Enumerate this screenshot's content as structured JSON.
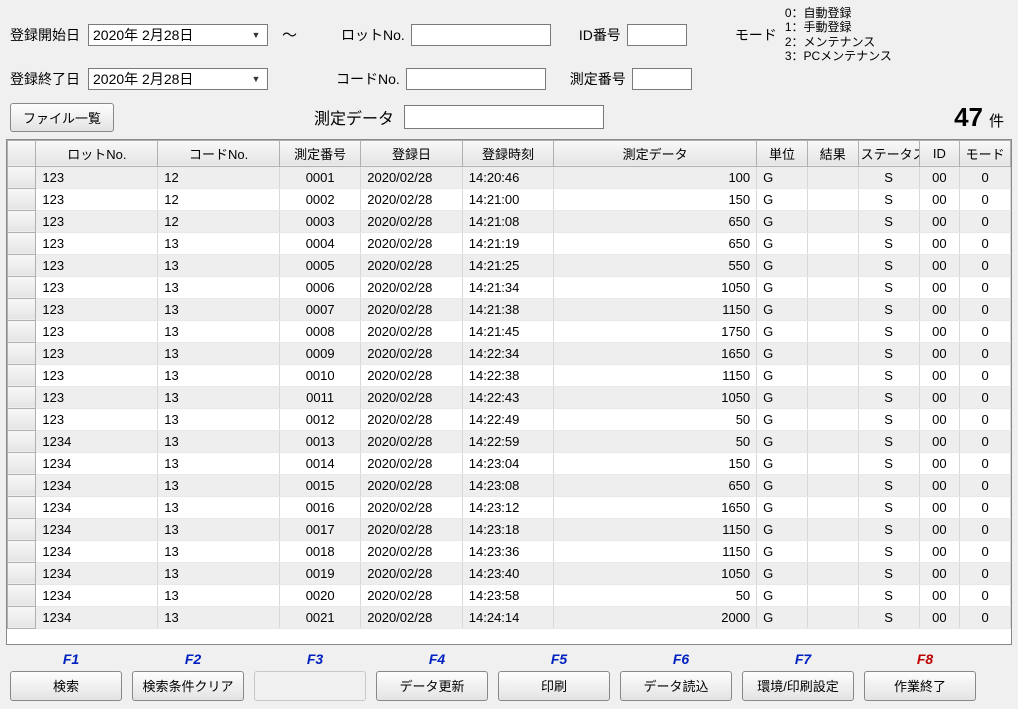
{
  "filters": {
    "start_label": "登録開始日",
    "start_date": "2020年 2月28日",
    "end_label": "登録終了日",
    "end_date": "2020年 2月28日",
    "tilde": "～",
    "lot_label": "ロットNo.",
    "lot_value": "",
    "code_label": "コードNo.",
    "code_value": "",
    "id_label": "ID番号",
    "id_value": "",
    "meas_no_label": "測定番号",
    "meas_no_value": "",
    "mode_label": "モード",
    "mode_legend": "0：自動登録\n1：手動登録\n2：メンテナンス\n3：PCメンテナンス"
  },
  "toolbar": {
    "file_list": "ファイル一覧",
    "meas_data_label": "測定データ",
    "meas_data_value": "",
    "count": "47",
    "count_unit": "件"
  },
  "grid": {
    "headers": [
      "",
      "ロットNo.",
      "コードNo.",
      "測定番号",
      "登録日",
      "登録時刻",
      "測定データ",
      "単位",
      "結果",
      "ステータス",
      "ID",
      "モード"
    ],
    "rows": [
      {
        "lot": "123",
        "code": "12",
        "no": "0001",
        "date": "2020/02/28",
        "time": "14:20:46",
        "data": "100",
        "unit": "G",
        "result": "",
        "status": "S",
        "id": "00",
        "mode": "0"
      },
      {
        "lot": "123",
        "code": "12",
        "no": "0002",
        "date": "2020/02/28",
        "time": "14:21:00",
        "data": "150",
        "unit": "G",
        "result": "",
        "status": "S",
        "id": "00",
        "mode": "0"
      },
      {
        "lot": "123",
        "code": "12",
        "no": "0003",
        "date": "2020/02/28",
        "time": "14:21:08",
        "data": "650",
        "unit": "G",
        "result": "",
        "status": "S",
        "id": "00",
        "mode": "0"
      },
      {
        "lot": "123",
        "code": "13",
        "no": "0004",
        "date": "2020/02/28",
        "time": "14:21:19",
        "data": "650",
        "unit": "G",
        "result": "",
        "status": "S",
        "id": "00",
        "mode": "0"
      },
      {
        "lot": "123",
        "code": "13",
        "no": "0005",
        "date": "2020/02/28",
        "time": "14:21:25",
        "data": "550",
        "unit": "G",
        "result": "",
        "status": "S",
        "id": "00",
        "mode": "0"
      },
      {
        "lot": "123",
        "code": "13",
        "no": "0006",
        "date": "2020/02/28",
        "time": "14:21:34",
        "data": "1050",
        "unit": "G",
        "result": "",
        "status": "S",
        "id": "00",
        "mode": "0"
      },
      {
        "lot": "123",
        "code": "13",
        "no": "0007",
        "date": "2020/02/28",
        "time": "14:21:38",
        "data": "1150",
        "unit": "G",
        "result": "",
        "status": "S",
        "id": "00",
        "mode": "0"
      },
      {
        "lot": "123",
        "code": "13",
        "no": "0008",
        "date": "2020/02/28",
        "time": "14:21:45",
        "data": "1750",
        "unit": "G",
        "result": "",
        "status": "S",
        "id": "00",
        "mode": "0"
      },
      {
        "lot": "123",
        "code": "13",
        "no": "0009",
        "date": "2020/02/28",
        "time": "14:22:34",
        "data": "1650",
        "unit": "G",
        "result": "",
        "status": "S",
        "id": "00",
        "mode": "0"
      },
      {
        "lot": "123",
        "code": "13",
        "no": "0010",
        "date": "2020/02/28",
        "time": "14:22:38",
        "data": "1150",
        "unit": "G",
        "result": "",
        "status": "S",
        "id": "00",
        "mode": "0"
      },
      {
        "lot": "123",
        "code": "13",
        "no": "0011",
        "date": "2020/02/28",
        "time": "14:22:43",
        "data": "1050",
        "unit": "G",
        "result": "",
        "status": "S",
        "id": "00",
        "mode": "0"
      },
      {
        "lot": "123",
        "code": "13",
        "no": "0012",
        "date": "2020/02/28",
        "time": "14:22:49",
        "data": "50",
        "unit": "G",
        "result": "",
        "status": "S",
        "id": "00",
        "mode": "0"
      },
      {
        "lot": "1234",
        "code": "13",
        "no": "0013",
        "date": "2020/02/28",
        "time": "14:22:59",
        "data": "50",
        "unit": "G",
        "result": "",
        "status": "S",
        "id": "00",
        "mode": "0"
      },
      {
        "lot": "1234",
        "code": "13",
        "no": "0014",
        "date": "2020/02/28",
        "time": "14:23:04",
        "data": "150",
        "unit": "G",
        "result": "",
        "status": "S",
        "id": "00",
        "mode": "0"
      },
      {
        "lot": "1234",
        "code": "13",
        "no": "0015",
        "date": "2020/02/28",
        "time": "14:23:08",
        "data": "650",
        "unit": "G",
        "result": "",
        "status": "S",
        "id": "00",
        "mode": "0"
      },
      {
        "lot": "1234",
        "code": "13",
        "no": "0016",
        "date": "2020/02/28",
        "time": "14:23:12",
        "data": "1650",
        "unit": "G",
        "result": "",
        "status": "S",
        "id": "00",
        "mode": "0"
      },
      {
        "lot": "1234",
        "code": "13",
        "no": "0017",
        "date": "2020/02/28",
        "time": "14:23:18",
        "data": "1150",
        "unit": "G",
        "result": "",
        "status": "S",
        "id": "00",
        "mode": "0"
      },
      {
        "lot": "1234",
        "code": "13",
        "no": "0018",
        "date": "2020/02/28",
        "time": "14:23:36",
        "data": "1150",
        "unit": "G",
        "result": "",
        "status": "S",
        "id": "00",
        "mode": "0"
      },
      {
        "lot": "1234",
        "code": "13",
        "no": "0019",
        "date": "2020/02/28",
        "time": "14:23:40",
        "data": "1050",
        "unit": "G",
        "result": "",
        "status": "S",
        "id": "00",
        "mode": "0"
      },
      {
        "lot": "1234",
        "code": "13",
        "no": "0020",
        "date": "2020/02/28",
        "time": "14:23:58",
        "data": "50",
        "unit": "G",
        "result": "",
        "status": "S",
        "id": "00",
        "mode": "0"
      },
      {
        "lot": "1234",
        "code": "13",
        "no": "0021",
        "date": "2020/02/28",
        "time": "14:24:14",
        "data": "2000",
        "unit": "G",
        "result": "",
        "status": "S",
        "id": "00",
        "mode": "0"
      }
    ]
  },
  "fkeys": {
    "labels": [
      "F1",
      "F2",
      "F3",
      "F4",
      "F5",
      "F6",
      "F7",
      "F8"
    ],
    "buttons": [
      "検索",
      "検索条件クリア",
      "",
      "データ更新",
      "印刷",
      "データ読込",
      "環境/印刷設定",
      "作業終了"
    ]
  }
}
